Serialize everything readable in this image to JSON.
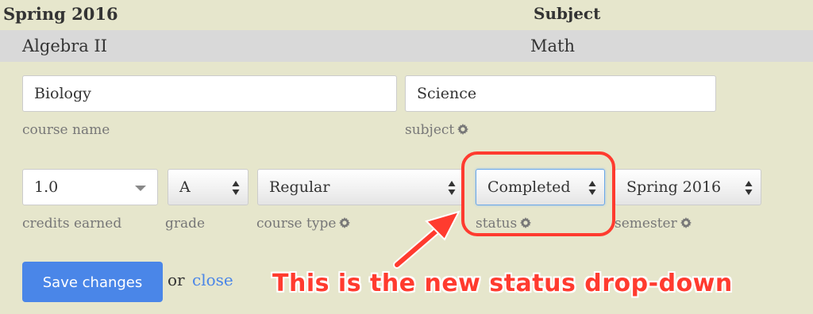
{
  "table": {
    "header": {
      "term": "Spring 2016",
      "subject": "Subject"
    },
    "row": {
      "course": "Algebra II",
      "subject": "Math"
    }
  },
  "form": {
    "course_name": {
      "value": "Biology",
      "label": "course name"
    },
    "subject": {
      "value": "Science",
      "label": "subject"
    },
    "credits": {
      "value": "1.0",
      "label": "credits earned"
    },
    "grade": {
      "value": "A",
      "label": "grade"
    },
    "course_type": {
      "value": "Regular",
      "label": "course type"
    },
    "status": {
      "value": "Completed",
      "label": "status"
    },
    "semester": {
      "value": "Spring 2016",
      "label": "semester"
    }
  },
  "actions": {
    "save_label": "Save changes",
    "or_text": "or",
    "close_label": "close"
  },
  "annotation": {
    "text": "This is the new status drop-down",
    "color": "#ff3b2f"
  },
  "colors": {
    "accent": "#4a86e8",
    "panel": "#e6e6cc",
    "row": "#d9d9d9"
  }
}
